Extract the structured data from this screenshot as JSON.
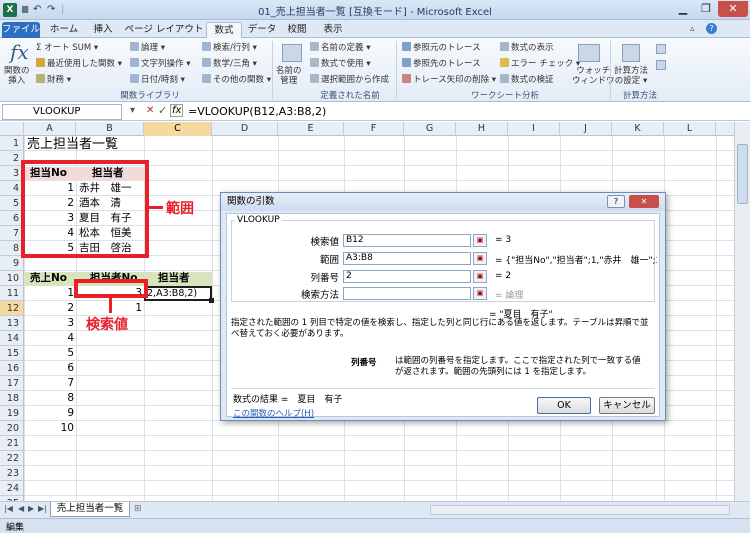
{
  "window": {
    "title": "01_売上担当者一覧 [互換モード] - Microsoft Excel",
    "qat_undo": "↶",
    "qat_redo": "↷",
    "qat_sep": "|"
  },
  "tabs": [
    {
      "label": "ファイル"
    },
    {
      "label": "ホーム"
    },
    {
      "label": "挿入"
    },
    {
      "label": "ページ レイアウト"
    },
    {
      "label": "数式"
    },
    {
      "label": "データ"
    },
    {
      "label": "校閲"
    },
    {
      "label": "表示"
    }
  ],
  "ribbon": {
    "insert_function": "関数の\n挿入",
    "fx": "fx",
    "autosum": "Σ オート SUM ▾",
    "recent": "最近使用した関数 ▾",
    "finance": "財務 ▾",
    "logical": "論理 ▾",
    "text": "文字列操作 ▾",
    "datetime": "日付/時刻 ▾",
    "lookup": "検索/行列 ▾",
    "math": "数学/三角 ▾",
    "other": "その他の関数 ▾",
    "group_library": "関数ライブラリ",
    "name_manager": "名前の\n管理",
    "define_name": "名前の定義 ▾",
    "use_in_formula": "数式で使用 ▾",
    "create_from_sel": "選択範囲から作成",
    "group_names": "定義された名前",
    "trace_prec": "参照元のトレース",
    "trace_dep": "参照先のトレース",
    "remove_arrows": "トレース矢印の削除 ▾",
    "show_formulas": "数式の表示",
    "error_check": "エラー チェック ▾",
    "eval_formula": "数式の検証",
    "watch": "ウォッチ\nウィンドウ",
    "group_audit": "ワークシート分析",
    "calc_options": "計算方法\nの設定 ▾",
    "group_calc": "計算方法"
  },
  "formula_bar": {
    "name_box": "VLOOKUP",
    "formula": "=VLOOKUP(B12,A3:B8,2)",
    "cancel": "✕",
    "enter": "✓",
    "fx": "fx"
  },
  "columns": [
    "A",
    "B",
    "C",
    "D",
    "E",
    "F",
    "G",
    "H",
    "I",
    "J",
    "K",
    "L"
  ],
  "rows": [
    "1",
    "2",
    "3",
    "4",
    "5",
    "6",
    "7",
    "8",
    "9",
    "10",
    "11",
    "12",
    "13",
    "14",
    "15",
    "16",
    "17",
    "18",
    "19",
    "20",
    "21",
    "22",
    "23",
    "24",
    "25"
  ],
  "sheet": {
    "title": "売上担当者一覧",
    "table1_headers": [
      "担当No",
      "担当者"
    ],
    "table1": [
      {
        "no": "1",
        "name": "赤井　雄一"
      },
      {
        "no": "2",
        "name": "酒本　清"
      },
      {
        "no": "3",
        "name": "夏目　有子"
      },
      {
        "no": "4",
        "name": "松本　恒美"
      },
      {
        "no": "5",
        "name": "吉田　啓治"
      }
    ],
    "table2_headers": [
      "売上No",
      "担当者No",
      "担当者"
    ],
    "table2_nos": [
      "1",
      "2",
      "3",
      "4",
      "5",
      "6",
      "7",
      "8",
      "9",
      "10"
    ],
    "b12": "3",
    "b13": "1",
    "c12_editing": "2,A3:B8,2)"
  },
  "annotations": {
    "range_label": "範囲",
    "lookup_label": "検索値"
  },
  "sheet_tabs": {
    "active": "売上担当者一覧"
  },
  "status": {
    "mode": "編集"
  },
  "dialog": {
    "title": "関数の引数",
    "help_btn": "?",
    "close_btn": "✕",
    "function_name": "VLOOKUP",
    "args": [
      {
        "label": "検索値",
        "value": "B12",
        "result": "= 3"
      },
      {
        "label": "範囲",
        "value": "A3:B8",
        "result": "= {\"担当No\",\"担当者\";1,\"赤井　雄一\";2,\""
      },
      {
        "label": "列番号",
        "value": "2",
        "result": "= 2"
      },
      {
        "label": "検索方法",
        "value": "",
        "result": "= 論理"
      }
    ],
    "overall_result": "= \"夏目　有子\"",
    "description": "指定された範囲の 1 列目で特定の値を検索し、指定した列と同じ行にある値を返します。テーブルは昇順で並べ替えておく必要があります。",
    "arg_help_label": "列番号",
    "arg_help_text": "は範囲の列番号を指定します。ここで指定された列で一致する値が返されます。範囲の先頭列には 1 を指定します。",
    "formula_result": "数式の結果 =　夏目　有子",
    "help_link": "この関数のヘルプ(H)",
    "ok": "OK",
    "cancel": "キャンセル",
    "ref_icon": "▣"
  },
  "colors": {
    "accent": "#2c6fc0",
    "red": "#e8202a",
    "header_pink": "#f2dcdb",
    "header_green": "#d8e4bc"
  }
}
